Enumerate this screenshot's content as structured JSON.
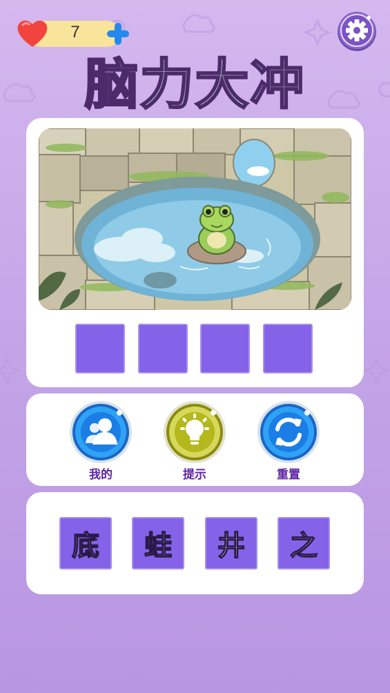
{
  "header": {
    "lives": "7",
    "title": "脑力大冲",
    "icons": {
      "heart": "heart-icon",
      "add": "plus-icon",
      "settings": "gear-icon"
    }
  },
  "puzzle": {
    "image": "frog-in-well-illustration",
    "answer_slots": [
      "",
      "",
      "",
      ""
    ]
  },
  "actions": {
    "mine": {
      "label": "我的",
      "icon": "users-icon",
      "color": "#1a7ee6"
    },
    "hint": {
      "label": "提示",
      "icon": "lightbulb-icon",
      "color": "#b4b81c"
    },
    "reset": {
      "label": "重置",
      "icon": "refresh-icon",
      "color": "#1a7ee6"
    }
  },
  "choices": {
    "chars": [
      "底",
      "蛙",
      "井",
      "之"
    ]
  },
  "colors": {
    "background": "#c9aceb",
    "tile": "#8463e8",
    "title_fill": "#b8ecd8",
    "title_stroke": "#4d2a6a",
    "label": "#5e24a4"
  }
}
